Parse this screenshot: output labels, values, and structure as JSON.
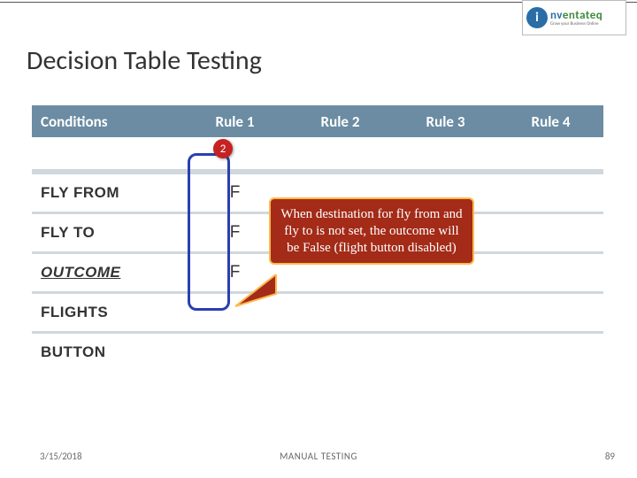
{
  "logo": {
    "badge_letter": "i",
    "name_prefix": "nv",
    "name_suffix": "entateq",
    "tagline": "Grow your Business Online"
  },
  "title": "Decision Table Testing",
  "table": {
    "header": {
      "conditions": "Conditions",
      "rule1": "Rule 1",
      "rule2": "Rule 2",
      "rule3": "Rule 3",
      "rule4": "Rule 4"
    },
    "rows": {
      "fly_from": {
        "label": "FLY FROM",
        "r1": "F"
      },
      "fly_to": {
        "label": "FLY TO",
        "r1": "F"
      },
      "outcome": {
        "label": "OUTCOME",
        "r1": "F"
      },
      "flights": {
        "label": "FLIGHTS"
      },
      "button": {
        "label": "BUTTON"
      }
    }
  },
  "badge": {
    "value": "2"
  },
  "callout": {
    "text": "When destination for fly from and fly to is not set, the outcome will be False (flight button disabled)"
  },
  "footer": {
    "date": "3/15/2018",
    "center": "MANUAL TESTING",
    "page": "89"
  }
}
